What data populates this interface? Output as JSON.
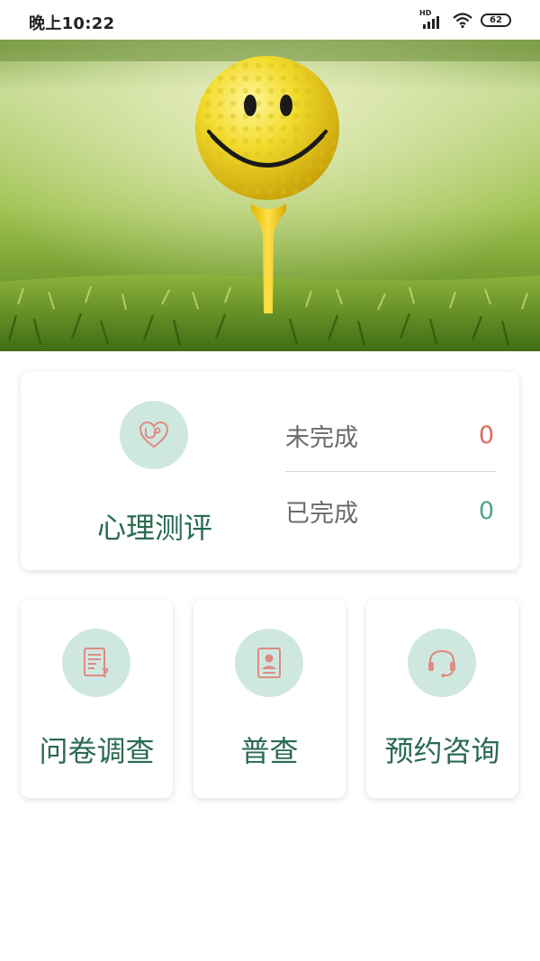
{
  "status_bar": {
    "time": "晚上10:22",
    "network_label": "HD",
    "battery": "62"
  },
  "banner": {
    "icon": "smiley-golf-ball"
  },
  "assessment_card": {
    "icon": "heart-stethoscope-icon",
    "title": "心理测评",
    "pending_label": "未完成",
    "pending_count": "0",
    "done_label": "已完成",
    "done_count": "0"
  },
  "menu": [
    {
      "icon": "questionnaire-icon",
      "label": "问卷调查"
    },
    {
      "icon": "profile-card-icon",
      "label": "普查"
    },
    {
      "icon": "headset-icon",
      "label": "预约咨询"
    }
  ],
  "colors": {
    "primary_text": "#2a6b4f",
    "icon_bg": "#cfe8df",
    "icon_stroke": "#e08a84",
    "pending_value": "#e06a62",
    "done_value": "#4ea58a",
    "label_text": "#6b6b6b"
  }
}
